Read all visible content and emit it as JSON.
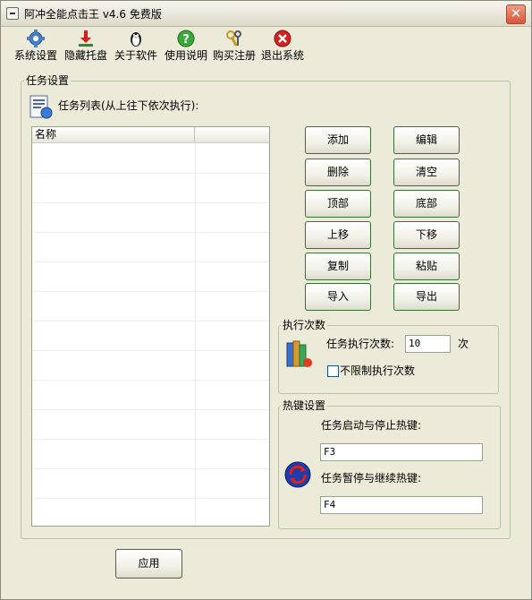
{
  "window": {
    "title": "阿冲全能点击王 v4.6 免费版"
  },
  "toolbar": {
    "items": [
      {
        "label": "系统设置",
        "icon": "gear-icon"
      },
      {
        "label": "隐藏托盘",
        "icon": "download-icon"
      },
      {
        "label": "关于软件",
        "icon": "penguin-icon"
      },
      {
        "label": "使用说明",
        "icon": "help-icon"
      },
      {
        "label": "购买注册",
        "icon": "keys-icon"
      },
      {
        "label": "退出系统",
        "icon": "exit-icon"
      }
    ]
  },
  "task_settings": {
    "legend": "任务设置",
    "list_caption": "任务列表(从上往下依次执行):",
    "columns": [
      "名称",
      ""
    ],
    "buttons": [
      "添加",
      "编辑",
      "删除",
      "清空",
      "顶部",
      "底部",
      "上移",
      "下移",
      "复制",
      "粘贴",
      "导入",
      "导出"
    ]
  },
  "execution": {
    "legend": "执行次数",
    "count_label": "任务执行次数:",
    "count_value": "10",
    "count_unit": "次",
    "unlimited_label": "不限制执行次数",
    "unlimited_checked": false
  },
  "hotkeys": {
    "legend": "热键设置",
    "start_stop_label": "任务启动与停止热键:",
    "start_stop_value": "F3",
    "pause_resume_label": "任务暂停与继续热键:",
    "pause_resume_value": "F4"
  },
  "apply_label": "应用"
}
